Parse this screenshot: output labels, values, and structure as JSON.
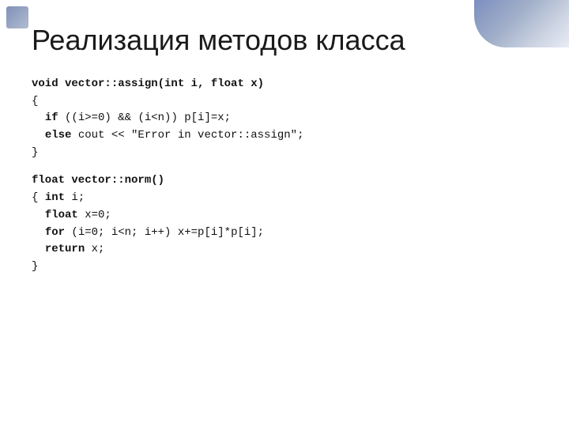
{
  "slide": {
    "title": "Реализация методов класса",
    "code_sections": [
      {
        "id": "section1",
        "lines": [
          {
            "text": "void vector::assign(int i, float x)",
            "bold": true,
            "indent": 0
          },
          {
            "text": "{",
            "bold": false,
            "indent": 0
          },
          {
            "text": "  if ((i>=0) && (i<n)) p[i]=x;",
            "bold": false,
            "indent": 0
          },
          {
            "text": "  else cout << \"Error in vector::assign\";",
            "bold": false,
            "indent": 0
          },
          {
            "text": "}",
            "bold": false,
            "indent": 0
          }
        ]
      },
      {
        "id": "section2",
        "lines": [
          {
            "text": "float vector::norm()",
            "bold": true,
            "indent": 0
          },
          {
            "text": "{ int i;",
            "bold_part": "int",
            "bold": false,
            "indent": 0
          },
          {
            "text": "  float x=0;",
            "bold_part": "float",
            "bold": false,
            "indent": 0
          },
          {
            "text": "  for (i=0; i<n; i++) x+=p[i]*p[i];",
            "bold_part": "for",
            "bold": false,
            "indent": 0
          },
          {
            "text": "  return x;",
            "bold_part": "return",
            "bold": false,
            "indent": 0
          },
          {
            "text": "}",
            "bold": false,
            "indent": 0
          }
        ]
      }
    ]
  }
}
